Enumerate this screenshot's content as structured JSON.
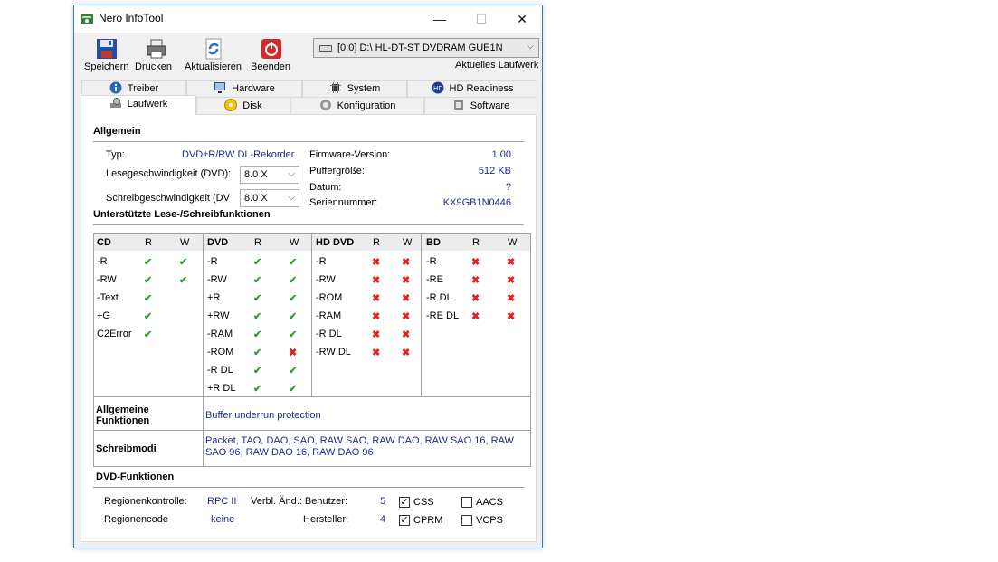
{
  "window": {
    "title": "Nero InfoTool",
    "controls": {
      "minimize": "—",
      "maximize": "☐",
      "close": "✕"
    }
  },
  "toolbar": {
    "save": "Speichern",
    "print": "Drucken",
    "refresh": "Aktualisieren",
    "exit": "Beenden"
  },
  "drive": {
    "selected": "[0:0]  D:\\ HL-DT-ST DVDRAM GUE1N",
    "caption": "Aktuelles Laufwerk"
  },
  "tabs": {
    "row1": [
      "Treiber",
      "Hardware",
      "System",
      "HD Readiness"
    ],
    "row2": [
      "Laufwerk",
      "Disk",
      "Konfiguration",
      "Software"
    ],
    "active": "Laufwerk"
  },
  "general": {
    "title": "Allgemein",
    "type_label": "Typ:",
    "type_value": "DVD±R/RW DL-Rekorder",
    "read_speed_label": "Lesegeschwindigkeit (DVD):",
    "read_speed_value": "8.0 X",
    "write_speed_label": "Schreibgeschwindigkeit (DVD",
    "write_speed_value": "8.0 X",
    "firmware_label": "Firmware-Version:",
    "firmware_value": "1.00",
    "buffer_label": "Puffergröße:",
    "buffer_value": "512 KB",
    "date_label": "Datum:",
    "date_value": "?",
    "serial_label": "Seriennummer:",
    "serial_value": "KX9GB1N0446"
  },
  "rw_functions": {
    "title": "Unterstützte Lese-/Schreibfunktionen",
    "r_header": "R",
    "w_header": "W",
    "groups": [
      {
        "name": "CD",
        "rows": [
          {
            "label": "-R",
            "r": true,
            "w": true
          },
          {
            "label": "-RW",
            "r": true,
            "w": true
          },
          {
            "label": "-Text",
            "r": true,
            "w": null
          },
          {
            "label": "+G",
            "r": true,
            "w": null
          },
          {
            "label": "C2Error",
            "r": true,
            "w": null
          }
        ]
      },
      {
        "name": "DVD",
        "rows": [
          {
            "label": "-R",
            "r": true,
            "w": true
          },
          {
            "label": "-RW",
            "r": true,
            "w": true
          },
          {
            "label": "+R",
            "r": true,
            "w": true
          },
          {
            "label": "+RW",
            "r": true,
            "w": true
          },
          {
            "label": "-RAM",
            "r": true,
            "w": true
          },
          {
            "label": "-ROM",
            "r": true,
            "w": false
          },
          {
            "label": "-R DL",
            "r": true,
            "w": true
          },
          {
            "label": "+R DL",
            "r": true,
            "w": true
          }
        ]
      },
      {
        "name": "HD DVD",
        "rows": [
          {
            "label": "-R",
            "r": false,
            "w": false
          },
          {
            "label": "-RW",
            "r": false,
            "w": false
          },
          {
            "label": "-ROM",
            "r": false,
            "w": false
          },
          {
            "label": "-RAM",
            "r": false,
            "w": false
          },
          {
            "label": "-R DL",
            "r": false,
            "w": false
          },
          {
            "label": "-RW DL",
            "r": false,
            "w": false
          }
        ]
      },
      {
        "name": "BD",
        "rows": [
          {
            "label": "-R",
            "r": false,
            "w": false
          },
          {
            "label": "-RE",
            "r": false,
            "w": false
          },
          {
            "label": "-R DL",
            "r": false,
            "w": false
          },
          {
            "label": "-RE DL",
            "r": false,
            "w": false
          }
        ]
      }
    ],
    "general_functions_label": "Allgemeine Funktionen",
    "general_functions_value": "Buffer underrun protection",
    "write_modes_label": "Schreibmodi",
    "write_modes_value": "Packet, TAO, DAO, SAO, RAW SAO, RAW DAO, RAW SAO 16, RAW SAO 96, RAW DAO 16, RAW DAO 96"
  },
  "dvd_functions": {
    "title": "DVD-Funktionen",
    "region_control_label": "Regionenkontrolle:",
    "region_control_value": "RPC II",
    "region_code_label": "Regionencode",
    "region_code_value": "keine",
    "changes_label": "Verbl. Änd.: Benutzer:",
    "changes_user_value": "5",
    "manufacturer_label": "Hersteller:",
    "manufacturer_value": "4",
    "features": [
      {
        "label": "CSS",
        "checked": true
      },
      {
        "label": "AACS",
        "checked": false
      },
      {
        "label": "CPRM",
        "checked": true
      },
      {
        "label": "VCPS",
        "checked": false
      }
    ]
  }
}
